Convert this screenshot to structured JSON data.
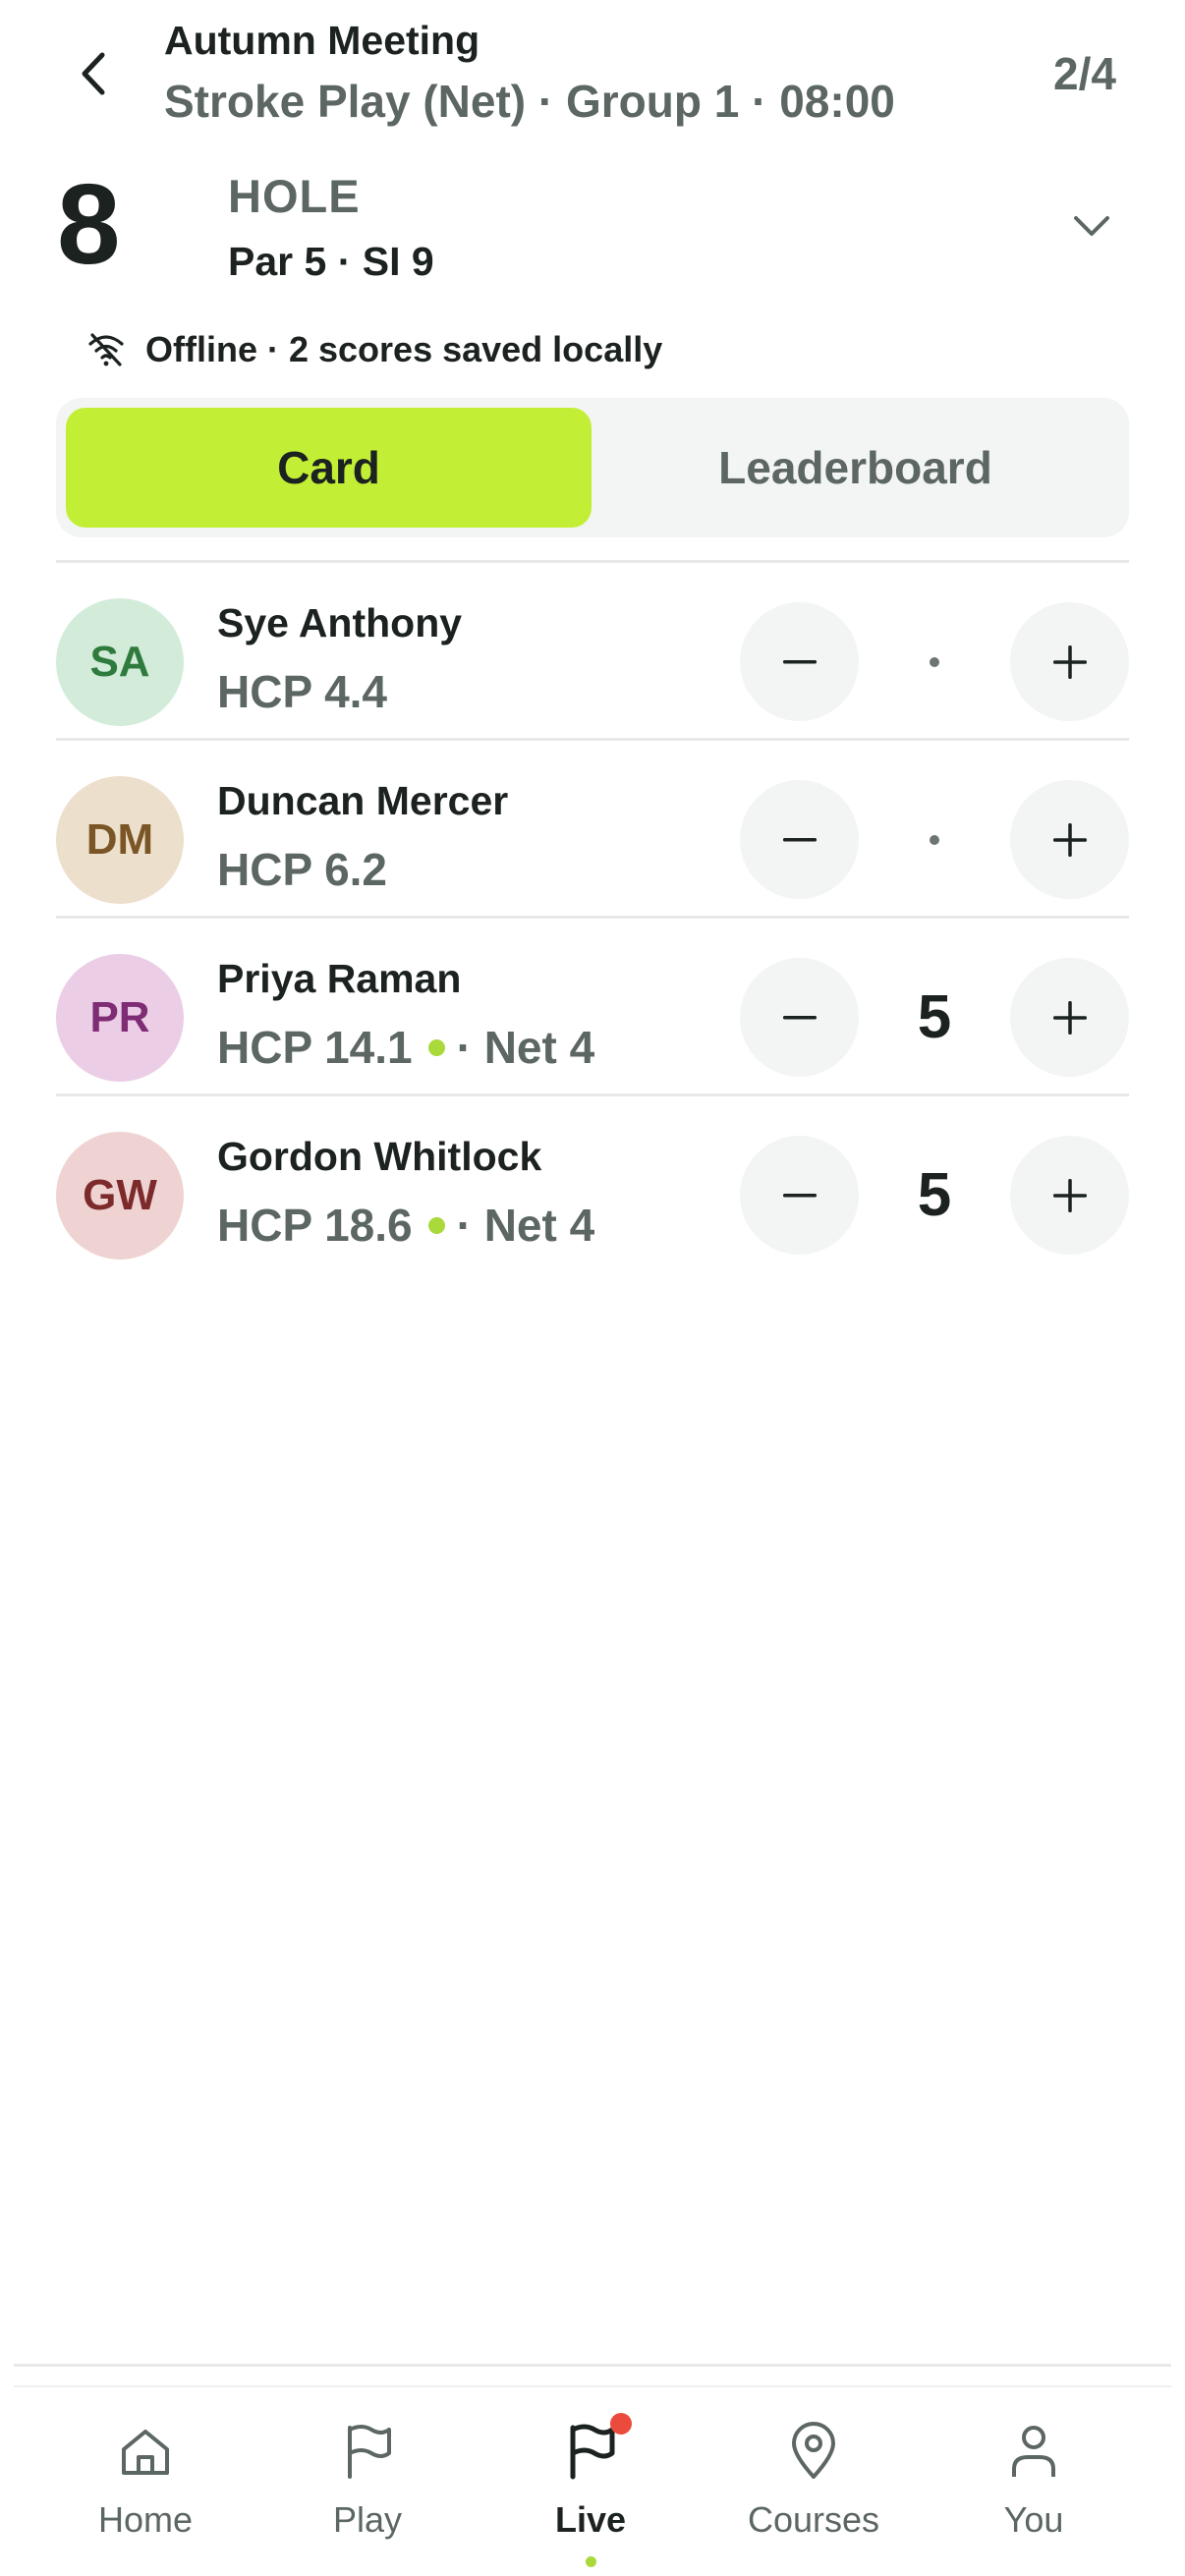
{
  "header": {
    "title": "Autumn Meeting",
    "subtitle": "Stroke Play (Net) · Group 1 · 08:00",
    "pager": "2/4"
  },
  "hole": {
    "number": "8",
    "label": "HOLE",
    "meta": "Par 5 · SI 9"
  },
  "status": {
    "text": "Offline · 2 scores saved locally",
    "icon": "wifi-off-icon"
  },
  "tabs": {
    "card": "Card",
    "leaderboard": "Leaderboard",
    "active": "card"
  },
  "players": [
    {
      "initials": "SA",
      "name": "Sye Anthony",
      "hcp": "HCP 4.4",
      "net": "",
      "score": "",
      "avatar_bg": "#d3ecd9",
      "avatar_fg": "#2f7b3e"
    },
    {
      "initials": "DM",
      "name": "Duncan Mercer",
      "hcp": "HCP 6.2",
      "net": "",
      "score": "",
      "avatar_bg": "#ecdfcc",
      "avatar_fg": "#7a5525"
    },
    {
      "initials": "PR",
      "name": "Priya Raman",
      "hcp": "HCP 14.1",
      "net": "· Net 4",
      "score": "5",
      "avatar_bg": "#ebcde6",
      "avatar_fg": "#7e2c74"
    },
    {
      "initials": "GW",
      "name": "Gordon Whitlock",
      "hcp": "HCP 18.6",
      "net": "· Net 4",
      "score": "5",
      "avatar_bg": "#efd3d3",
      "avatar_fg": "#7c2a2a"
    }
  ],
  "nav": {
    "home": "Home",
    "play": "Play",
    "live": "Live",
    "courses": "Courses",
    "you": "You",
    "active": "live"
  },
  "colors": {
    "accent": "#c2ef35",
    "dot": "#a9d93a",
    "badge": "#ea4b3c"
  }
}
